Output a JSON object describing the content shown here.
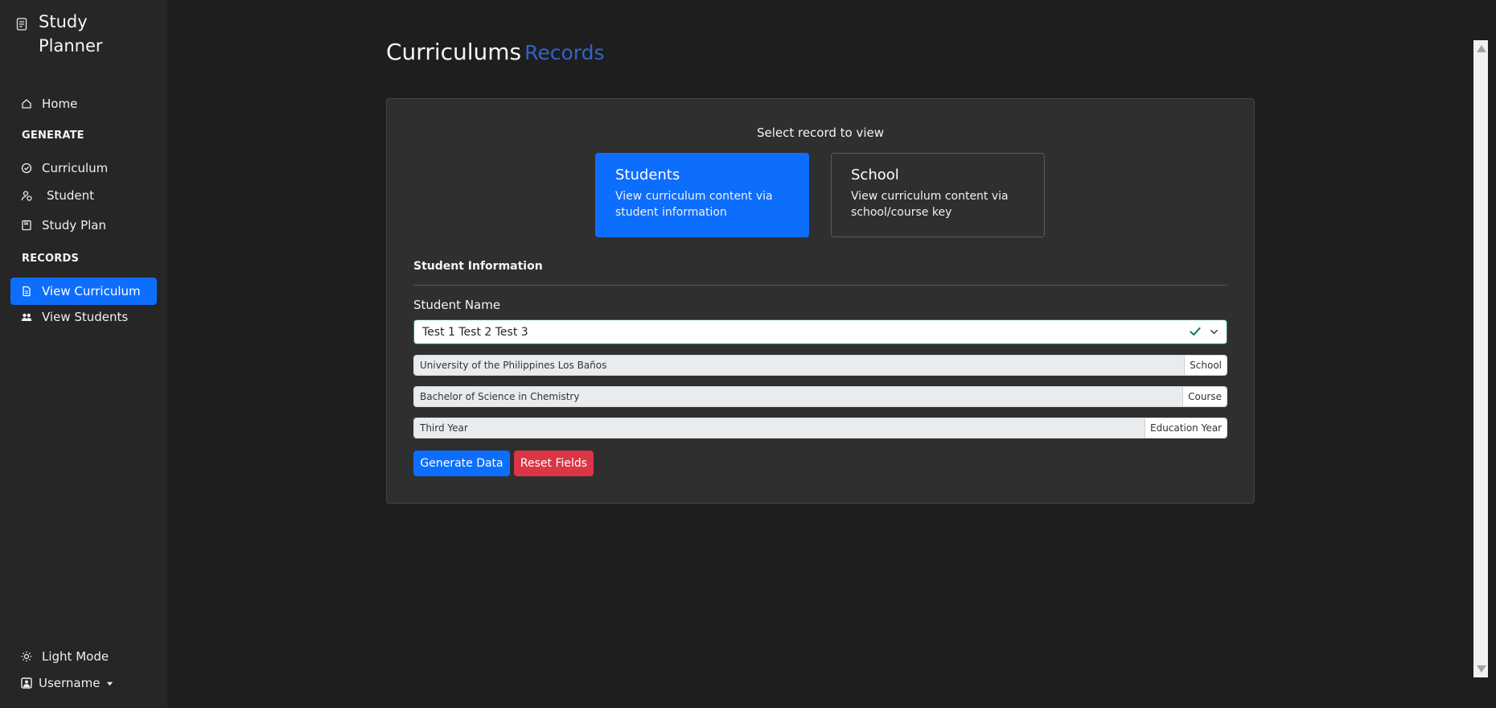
{
  "app": {
    "title": "Study Planner"
  },
  "sidebar": {
    "home": "Home",
    "generate_section": "GENERATE",
    "generate_items": [
      "Curriculum",
      "Student",
      "Study Plan"
    ],
    "records_section": "RECORDS",
    "records_items": [
      "View Curriculum",
      "View Students"
    ],
    "active_item": "View Curriculum",
    "light_mode": "Light Mode",
    "username": "Username"
  },
  "main": {
    "title": "Curriculums",
    "title_accent": "Records",
    "select_prompt": "Select record to view",
    "options": [
      {
        "title": "Students",
        "description": "View curriculum content via student information",
        "selected": true
      },
      {
        "title": "School",
        "description": "View curriculum content via school/course key",
        "selected": false
      }
    ],
    "section_heading": "Student Information",
    "student_name_label": "Student Name",
    "student_name_value": "Test 1 Test 2 Test 3",
    "fields": [
      {
        "value": "University of the Philippines Los Baños",
        "tag": "School"
      },
      {
        "value": "Bachelor of Science in Chemistry",
        "tag": "Course"
      },
      {
        "value": "Third Year",
        "tag": "Education Year"
      }
    ],
    "buttons": {
      "generate": "Generate Data",
      "reset": "Reset Fields"
    }
  },
  "colors": {
    "primary": "#0d6efd",
    "danger": "#dc3545",
    "success": "#198754",
    "accent_title": "#2f64c8",
    "background": "#1e1e1e",
    "sidebar": "#262626",
    "card": "#2f2f2f"
  }
}
